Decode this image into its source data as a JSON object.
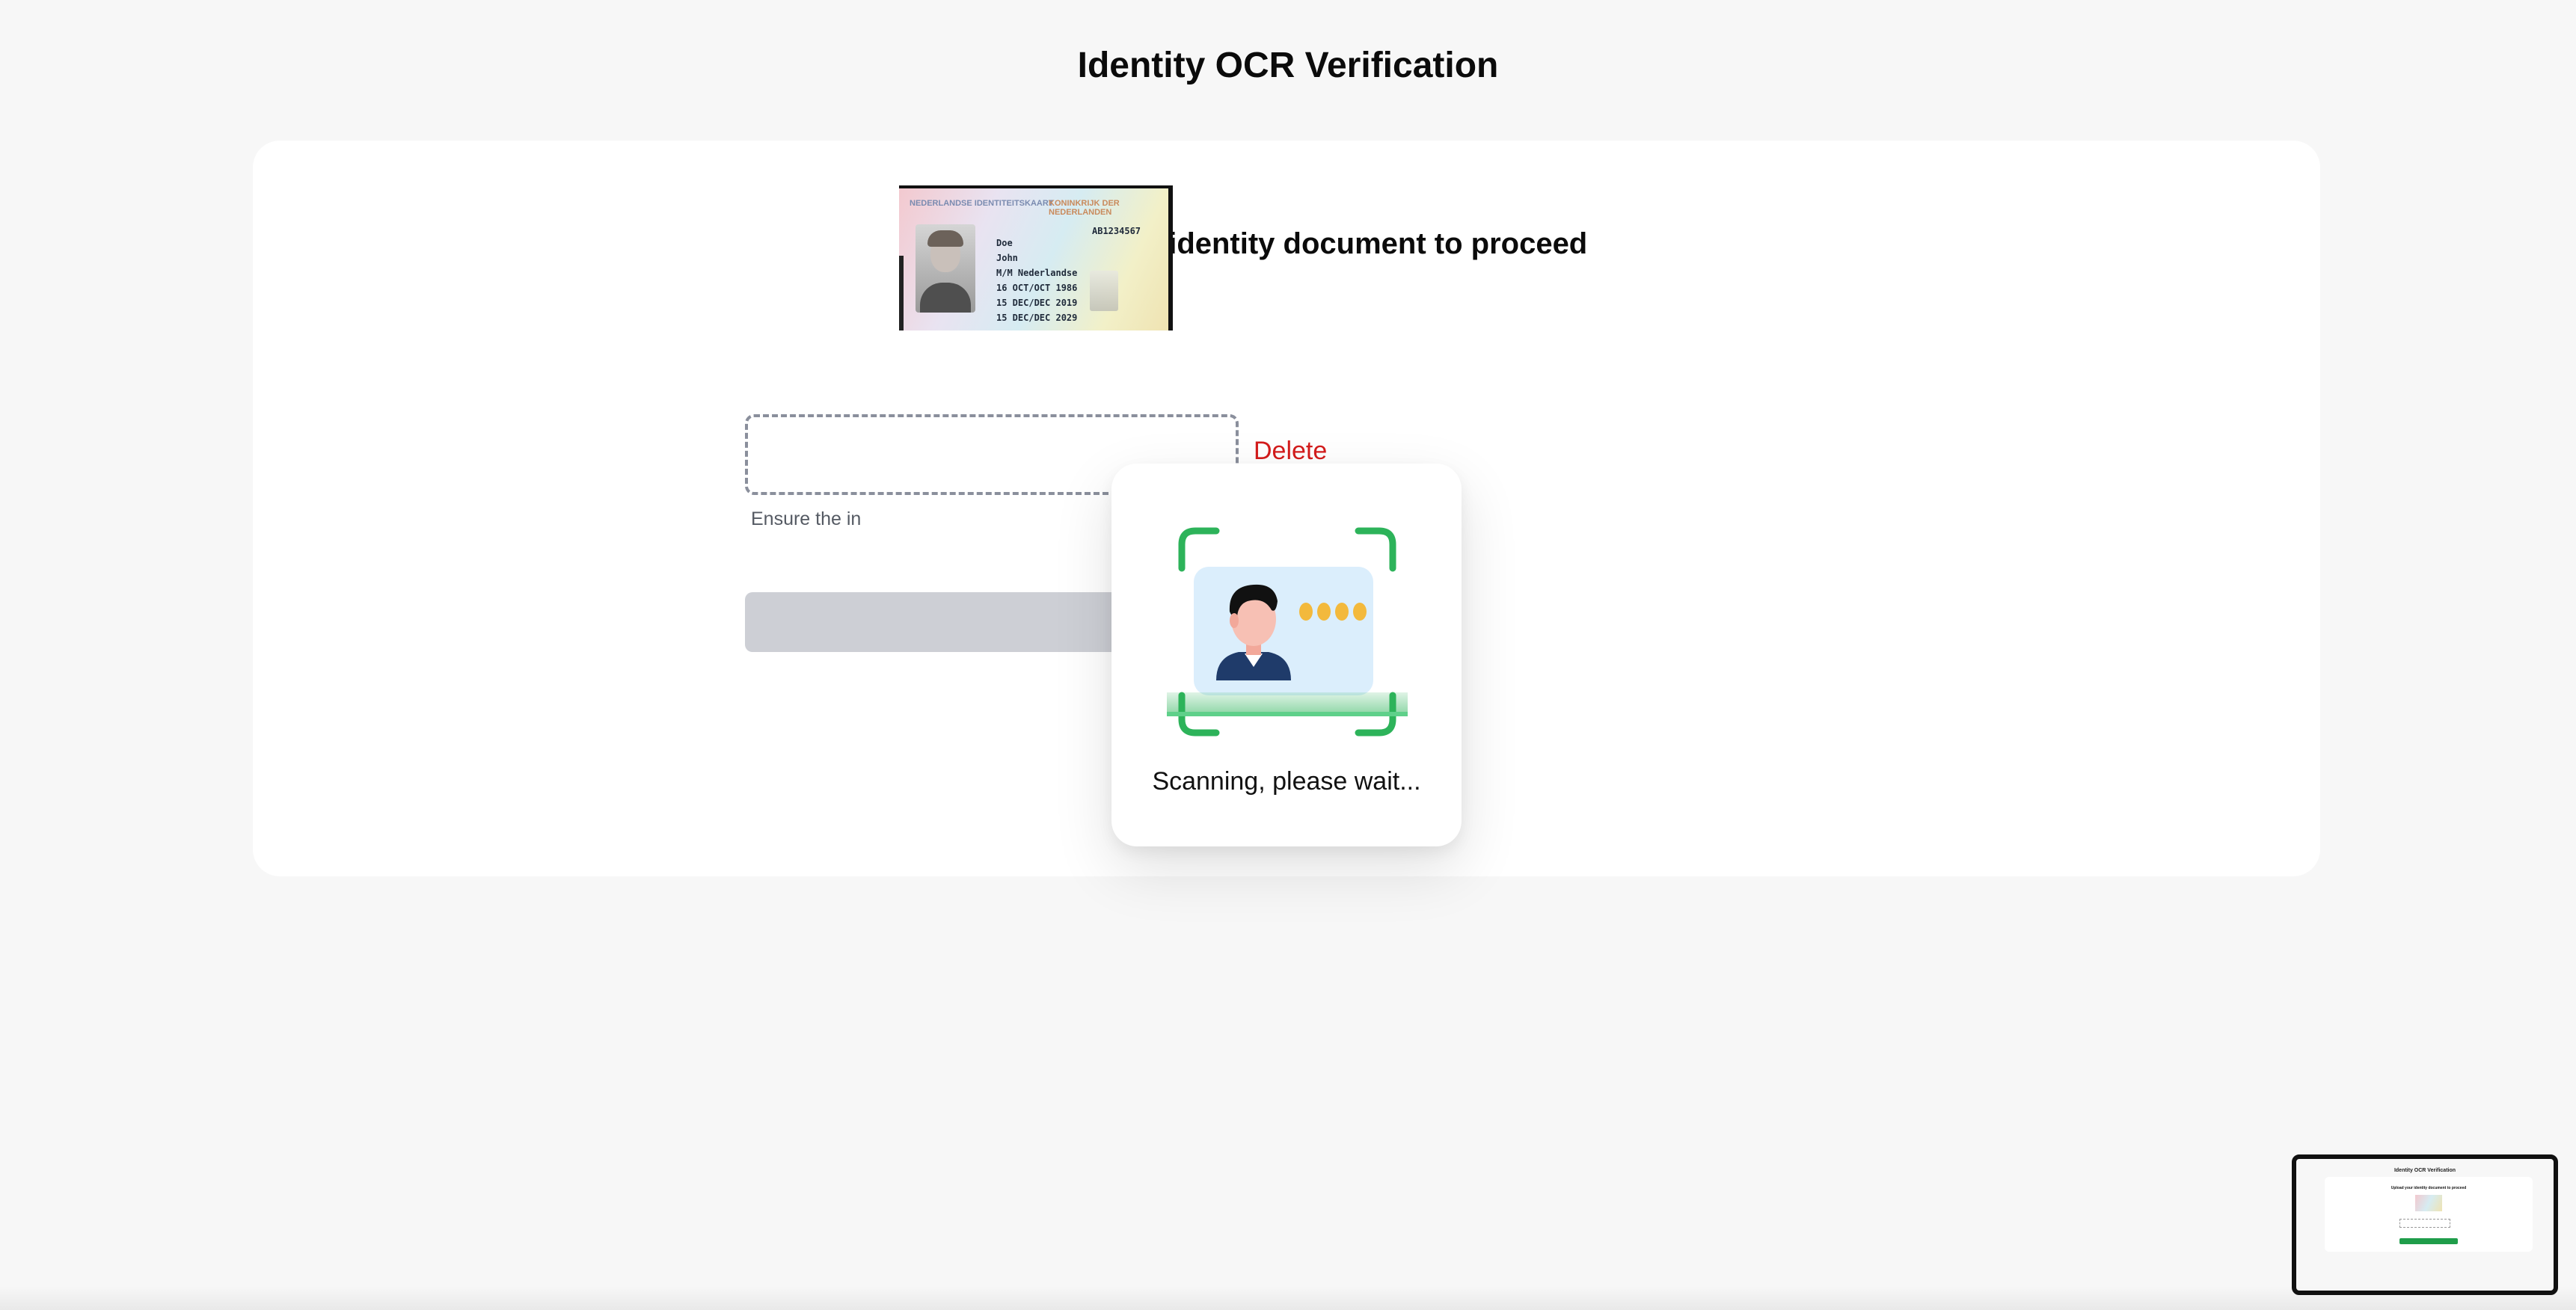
{
  "page": {
    "title": "Identity OCR Verification"
  },
  "upload": {
    "subtitle": "Upload your identity document to proceed",
    "delete_label": "Delete",
    "hint": "Ensure the in"
  },
  "id_card": {
    "header_left": "NEDERLANDSE IDENTITEITSKAART",
    "header_right": "KONINKRIJK DER NEDERLANDEN",
    "doc_number": "AB1234567",
    "surname": "Doe",
    "given_name": "John",
    "sex_nationality": "M/M   Nederlandse",
    "birth_date": "16 OCT/OCT   1986",
    "issue_date": "15 DEC/DEC 2019",
    "expiry_date": "15 DEC/DEC 2029"
  },
  "modal": {
    "status_text": "Scanning, please wait...",
    "icon": "id-scan-icon"
  },
  "minimap": {
    "title": "Identity OCR Verification",
    "subtitle": "Upload your identity document to proceed"
  },
  "colors": {
    "accent_green": "#2db35a",
    "delete_red": "#d41c1c",
    "button_disabled": "#cdcfd5",
    "background": "#f7f7f7"
  }
}
